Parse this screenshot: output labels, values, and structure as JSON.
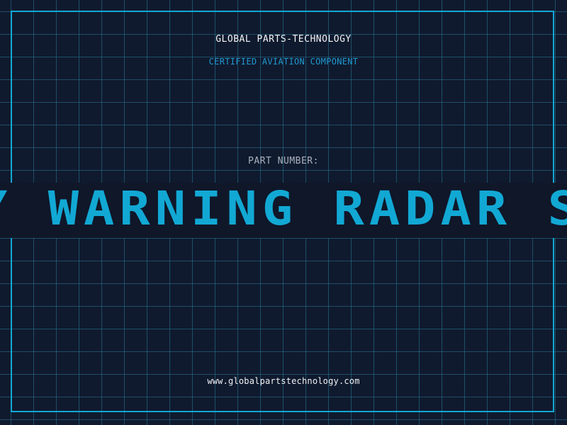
{
  "header": {
    "company": "GLOBAL PARTS-TECHNOLOGY",
    "subtitle": "CERTIFIED AVIATION COMPONENT"
  },
  "part": {
    "label": "PART NUMBER:",
    "number": "Y WARNING RADAR SY"
  },
  "footer": {
    "website": "www.globalpartstechnology.com"
  },
  "colors": {
    "background": "#101a2e",
    "grid": "#287896",
    "accent": "#12a8d4",
    "text": "#f2f4f6"
  }
}
